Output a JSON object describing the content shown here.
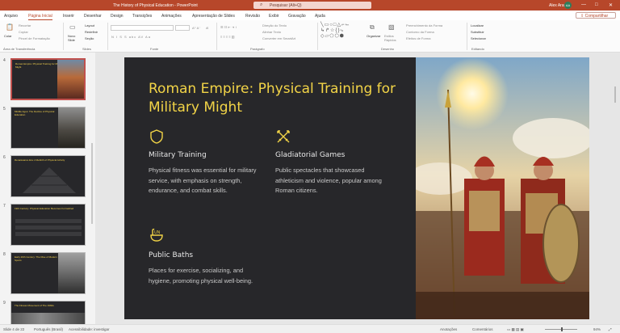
{
  "titlebar": {
    "document_title": "The History of Physical Education  -  PowerPoint",
    "search_placeholder": "Pesquisar (Alt+Q)",
    "user_name": "Alex Araujo",
    "user_initials": "AA"
  },
  "menu": {
    "tabs": [
      "Arquivo",
      "Página Inicial",
      "Inserir",
      "Desenhar",
      "Design",
      "Transições",
      "Animações",
      "Apresentação de Slides",
      "Revisão",
      "Exibir",
      "Gravação",
      "Ajuda"
    ],
    "active_tab": "Página Inicial",
    "share_label": "Compartilhar"
  },
  "ribbon": {
    "clipboard": {
      "paste": "Colar",
      "cut": "Recortar",
      "copy": "Copiar",
      "format_painter": "Pincel de Formatação",
      "group": "Área de Transferência"
    },
    "slides": {
      "new_slide": "Novo Slide",
      "layout": "Layout",
      "reset": "Redefinir",
      "section": "Seção",
      "group": "Slides"
    },
    "font": {
      "group": "Fonte",
      "buttons": "N  I  S  S  abc  AV  Aa"
    },
    "paragraph": {
      "text_direction": "Direção do Texto",
      "align_text": "Alinhar Texto",
      "smartart": "Converter em SmartArt",
      "group": "Parágrafo"
    },
    "drawing": {
      "arrange": "Organizar",
      "quick_styles": "Estilos Rápidos",
      "fill": "Preenchimento da Forma",
      "outline": "Contorno da Forma",
      "effects": "Efeitos de Forma",
      "group": "Desenho"
    },
    "editing": {
      "find": "Localizar",
      "replace": "Substituir",
      "select": "Selecionar",
      "group": "Editando"
    }
  },
  "thumbnails": [
    {
      "num": "4",
      "title": "Roman Empire: Physical Training for Military Might",
      "selected": true
    },
    {
      "num": "5",
      "title": "Middle Ages: The Decline of Physical Education",
      "selected": false
    },
    {
      "num": "6",
      "title": "Renaissance Era: A Rebirth of Physical Activity",
      "selected": false
    },
    {
      "num": "7",
      "title": "19th Century: Physical Education Becomes Formalized",
      "selected": false
    },
    {
      "num": "8",
      "title": "Early 20th Century: The Rise of Modern Sports",
      "selected": false
    },
    {
      "num": "9",
      "title": "The Fitness Movement of The 1960s",
      "selected": false
    }
  ],
  "slide": {
    "title": "Roman Empire: Physical Training for Military Might",
    "blocks": [
      {
        "heading": "Military Training",
        "body": "Physical fitness was essential for military service, with emphasis on strength, endurance, and combat skills."
      },
      {
        "heading": "Gladiatorial Games",
        "body": "Public spectacles that showcased athleticism and violence, popular among Roman citizens."
      },
      {
        "heading": "Public Baths",
        "body": "Places for exercise, socializing, and hygiene, promoting physical well-being."
      }
    ]
  },
  "status": {
    "slide_counter": "Slide 4 de 22",
    "language": "Português (Brasil)",
    "accessibility": "Acessibilidade: investigar",
    "notes": "Anotações",
    "comments": "Comentários",
    "zoom": "94%"
  }
}
